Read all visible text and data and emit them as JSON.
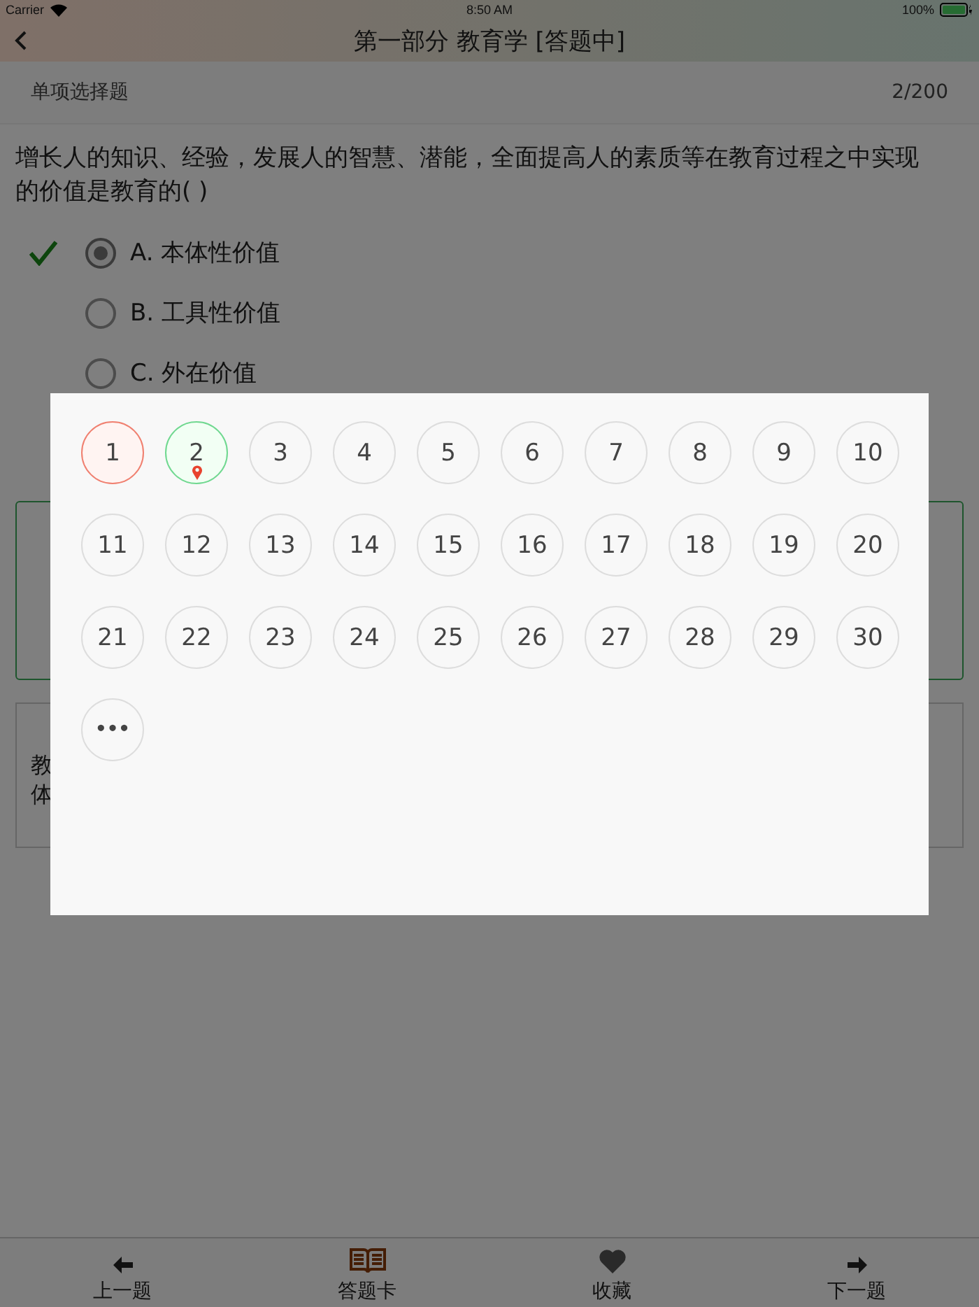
{
  "status_bar": {
    "carrier": "Carrier",
    "time": "8:50 AM",
    "battery": "100%"
  },
  "header": {
    "title": "第一部分 教育学 [答题中]"
  },
  "subheader": {
    "type": "单项选择题",
    "progress": "2/200"
  },
  "question": {
    "text": "增长人的知识、经验，发展人的智慧、潜能，全面提高人的素质等在教育过程之中实现的价值是教育的(    )",
    "options": [
      {
        "label": "A. 本体性价值",
        "selected": true,
        "correct": true
      },
      {
        "label": "B. 工具性价值",
        "selected": false,
        "correct": false
      },
      {
        "label": "C. 外在价值",
        "selected": false,
        "correct": false
      }
    ]
  },
  "reference_box": {
    "lines": [
      "教",
      "体"
    ]
  },
  "answer_card": {
    "items": [
      {
        "kind": "number",
        "label": "1",
        "wrong": true,
        "current": false
      },
      {
        "kind": "number",
        "label": "2",
        "wrong": false,
        "current": true
      },
      {
        "kind": "number",
        "label": "3",
        "wrong": false,
        "current": false
      },
      {
        "kind": "number",
        "label": "4",
        "wrong": false,
        "current": false
      },
      {
        "kind": "number",
        "label": "5",
        "wrong": false,
        "current": false
      },
      {
        "kind": "number",
        "label": "6",
        "wrong": false,
        "current": false
      },
      {
        "kind": "number",
        "label": "7",
        "wrong": false,
        "current": false
      },
      {
        "kind": "number",
        "label": "8",
        "wrong": false,
        "current": false
      },
      {
        "kind": "number",
        "label": "9",
        "wrong": false,
        "current": false
      },
      {
        "kind": "number",
        "label": "10",
        "wrong": false,
        "current": false
      },
      {
        "kind": "number",
        "label": "11",
        "wrong": false,
        "current": false
      },
      {
        "kind": "number",
        "label": "12",
        "wrong": false,
        "current": false
      },
      {
        "kind": "number",
        "label": "13",
        "wrong": false,
        "current": false
      },
      {
        "kind": "number",
        "label": "14",
        "wrong": false,
        "current": false
      },
      {
        "kind": "number",
        "label": "15",
        "wrong": false,
        "current": false
      },
      {
        "kind": "number",
        "label": "16",
        "wrong": false,
        "current": false
      },
      {
        "kind": "number",
        "label": "17",
        "wrong": false,
        "current": false
      },
      {
        "kind": "number",
        "label": "18",
        "wrong": false,
        "current": false
      },
      {
        "kind": "number",
        "label": "19",
        "wrong": false,
        "current": false
      },
      {
        "kind": "number",
        "label": "20",
        "wrong": false,
        "current": false
      },
      {
        "kind": "number",
        "label": "21",
        "wrong": false,
        "current": false
      },
      {
        "kind": "number",
        "label": "22",
        "wrong": false,
        "current": false
      },
      {
        "kind": "number",
        "label": "23",
        "wrong": false,
        "current": false
      },
      {
        "kind": "number",
        "label": "24",
        "wrong": false,
        "current": false
      },
      {
        "kind": "number",
        "label": "25",
        "wrong": false,
        "current": false
      },
      {
        "kind": "number",
        "label": "26",
        "wrong": false,
        "current": false
      },
      {
        "kind": "number",
        "label": "27",
        "wrong": false,
        "current": false
      },
      {
        "kind": "number",
        "label": "28",
        "wrong": false,
        "current": false
      },
      {
        "kind": "number",
        "label": "29",
        "wrong": false,
        "current": false
      },
      {
        "kind": "number",
        "label": "30",
        "wrong": false,
        "current": false
      },
      {
        "kind": "more",
        "label": "•••",
        "wrong": false,
        "current": false
      }
    ]
  },
  "tab_bar": [
    {
      "kind": "prev",
      "label": "上一题"
    },
    {
      "kind": "card",
      "label": "答题卡"
    },
    {
      "kind": "favorite",
      "label": "收藏"
    },
    {
      "kind": "next",
      "label": "下一题"
    }
  ]
}
